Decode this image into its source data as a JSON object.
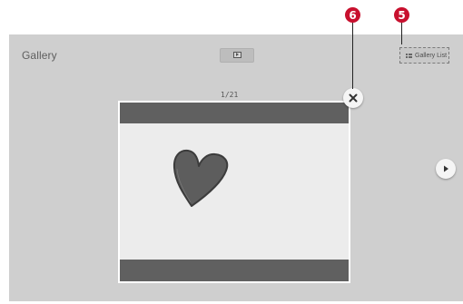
{
  "gallery": {
    "title": "Gallery",
    "page_counter": "1/21",
    "list_button_label": "Gallery List"
  },
  "photo": {
    "subject_icon": "heart-icon"
  },
  "callouts": {
    "close_marker": "6",
    "list_marker": "5"
  },
  "colors": {
    "panel_bg": "#cfcfcf",
    "frame_bars": "#606060",
    "callout": "#c8102e"
  }
}
